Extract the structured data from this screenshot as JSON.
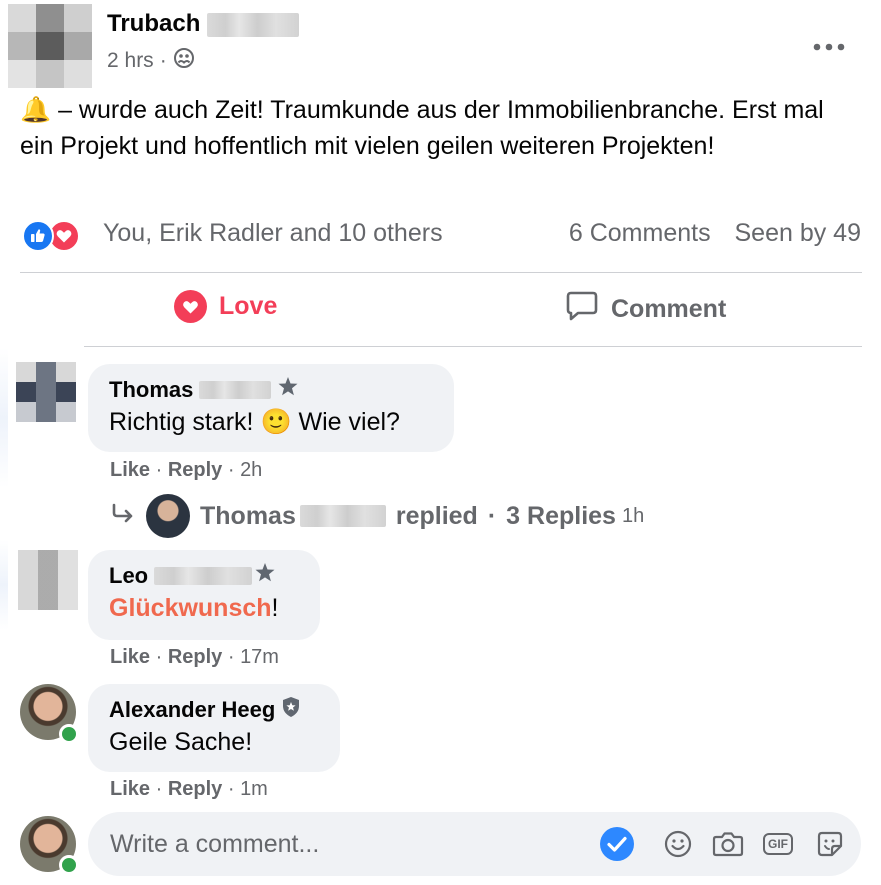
{
  "post": {
    "author": "Trubach",
    "time": "2 hrs",
    "separator": "·",
    "audience_icon": "friends-icon",
    "more_icon": "more-options-icon",
    "emoji": "🔔",
    "text": " – wurde auch Zeit! Traumkunde aus der Immobilienbranche. Erst mal ein Projekt und hoffentlich mit vielen geilen weiteren Projekten!"
  },
  "stats": {
    "reaction_icons": [
      "like-icon",
      "love-icon"
    ],
    "reactors": "You, Erik Radler and 10 others",
    "comments": "6 Comments",
    "seen": "Seen by 49"
  },
  "actions": {
    "love": "Love",
    "comment": "Comment"
  },
  "comments": [
    {
      "name": "Thomas",
      "text_before": "Richtig stark! ",
      "emoji": "🙂",
      "text_after": " Wie viel?",
      "like": "Like",
      "reply": "Reply",
      "time": "2h",
      "replies": {
        "name": "Thomas",
        "replied": "replied",
        "count": "3 Replies",
        "time": "1h"
      }
    },
    {
      "name": "Leo",
      "text_highlight": "Glückwunsch",
      "text_after": "!",
      "like": "Like",
      "reply": "Reply",
      "time": "17m"
    },
    {
      "name": "Alexander Heeg",
      "text": "Geile Sache!",
      "like": "Like",
      "reply": "Reply",
      "time": "1m"
    }
  ],
  "composer": {
    "placeholder": "Write a comment...",
    "icons": [
      "checkmark-icon",
      "emoji-icon",
      "camera-icon",
      "gif-icon",
      "sticker-icon"
    ],
    "gif_label": "GIF"
  },
  "colors": {
    "love": "#f33e58",
    "like": "#1877f2",
    "accent_text": "#f0694e",
    "bubble": "#f0f2f5",
    "secondary_text": "#65676b",
    "online": "#31a24c"
  }
}
